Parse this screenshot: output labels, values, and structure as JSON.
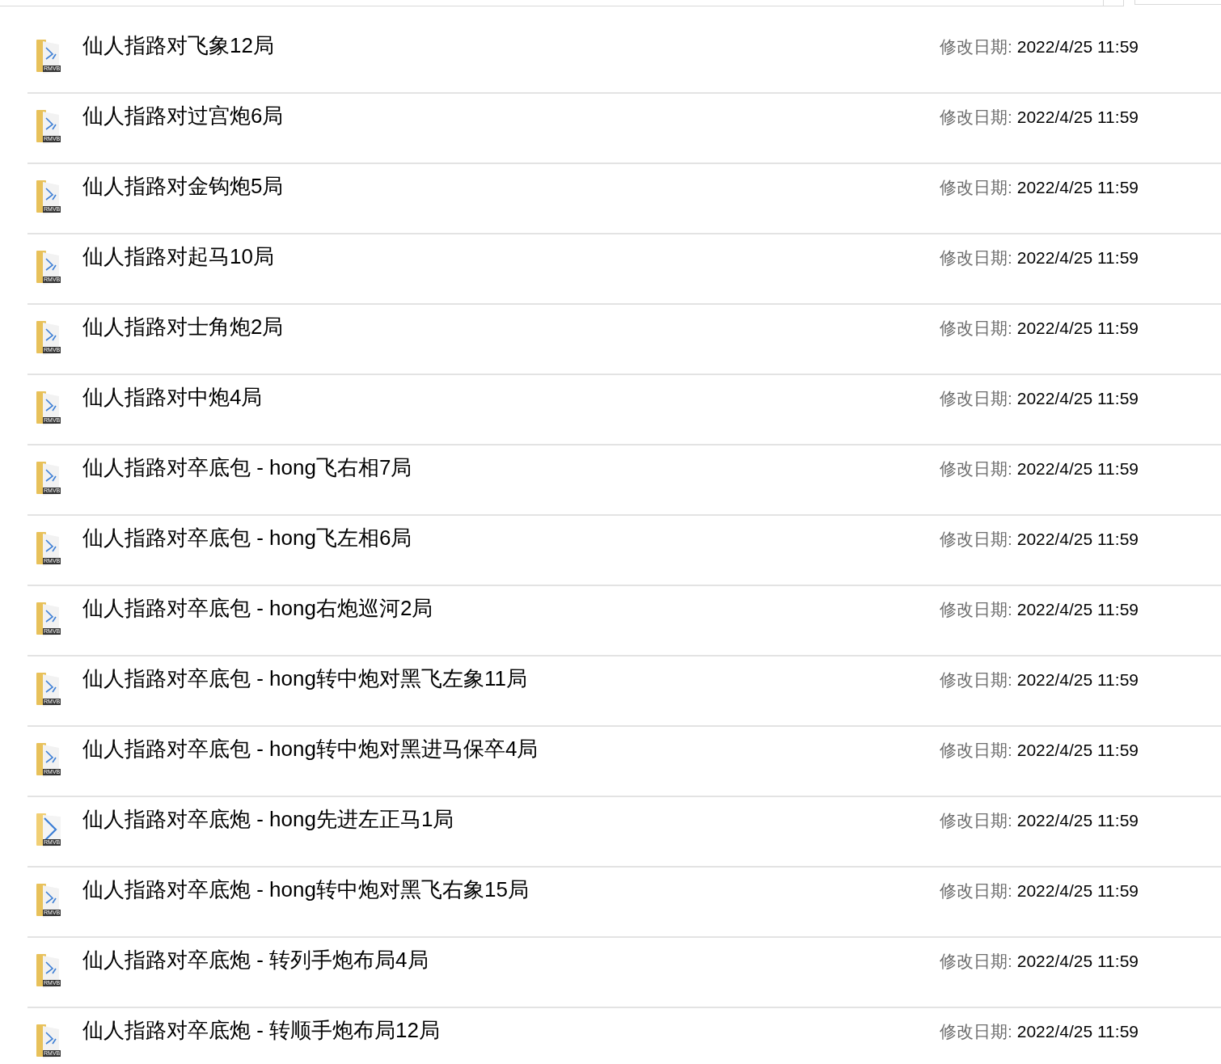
{
  "files": [
    {
      "name": "仙人指路对飞象12局",
      "kind": "folder",
      "icon_label": "RMVB",
      "date_label": "修改日期:",
      "date": "2022/4/25 11:59"
    },
    {
      "name": "仙人指路对过宫炮6局",
      "kind": "folder",
      "icon_label": "RMVB",
      "date_label": "修改日期:",
      "date": "2022/4/25 11:59"
    },
    {
      "name": "仙人指路对金钩炮5局",
      "kind": "folder",
      "icon_label": "RMVB",
      "date_label": "修改日期:",
      "date": "2022/4/25 11:59"
    },
    {
      "name": "仙人指路对起马10局",
      "kind": "folder",
      "icon_label": "RMVB",
      "date_label": "修改日期:",
      "date": "2022/4/25 11:59"
    },
    {
      "name": "仙人指路对士角炮2局",
      "kind": "folder",
      "icon_label": "RMVB",
      "date_label": "修改日期:",
      "date": "2022/4/25 11:59"
    },
    {
      "name": "仙人指路对中炮4局",
      "kind": "folder",
      "icon_label": "RMVB",
      "date_label": "修改日期:",
      "date": "2022/4/25 11:59"
    },
    {
      "name": "仙人指路对卒底包 - hong飞右相7局",
      "kind": "folder",
      "icon_label": "RMVB",
      "date_label": "修改日期:",
      "date": "2022/4/25 11:59"
    },
    {
      "name": "仙人指路对卒底包 - hong飞左相6局",
      "kind": "folder",
      "icon_label": "RMVB",
      "date_label": "修改日期:",
      "date": "2022/4/25 11:59"
    },
    {
      "name": "仙人指路对卒底包 - hong右炮巡河2局",
      "kind": "folder",
      "icon_label": "RMVB",
      "date_label": "修改日期:",
      "date": "2022/4/25 11:59"
    },
    {
      "name": "仙人指路对卒底包 - hong转中炮对黑飞左象11局",
      "kind": "folder",
      "icon_label": "RMVB",
      "date_label": "修改日期:",
      "date": "2022/4/25 11:59"
    },
    {
      "name": "仙人指路对卒底包 - hong转中炮对黑进马保卒4局",
      "kind": "folder",
      "icon_label": "RMVB",
      "date_label": "修改日期:",
      "date": "2022/4/25 11:59"
    },
    {
      "name": "仙人指路对卒底炮 - hong先进左正马1局",
      "kind": "single",
      "icon_label": "RMVB",
      "date_label": "修改日期:",
      "date": "2022/4/25 11:59"
    },
    {
      "name": "仙人指路对卒底炮 - hong转中炮对黑飞右象15局",
      "kind": "folder",
      "icon_label": "RMVB",
      "date_label": "修改日期:",
      "date": "2022/4/25 11:59"
    },
    {
      "name": "仙人指路对卒底炮 - 转列手炮布局4局",
      "kind": "folder",
      "icon_label": "RMVB",
      "date_label": "修改日期:",
      "date": "2022/4/25 11:59"
    },
    {
      "name": "仙人指路对卒底炮 - 转顺手炮布局12局",
      "kind": "folder",
      "icon_label": "RMVB",
      "date_label": "修改日期:",
      "date": "2022/4/25 11:59"
    }
  ]
}
